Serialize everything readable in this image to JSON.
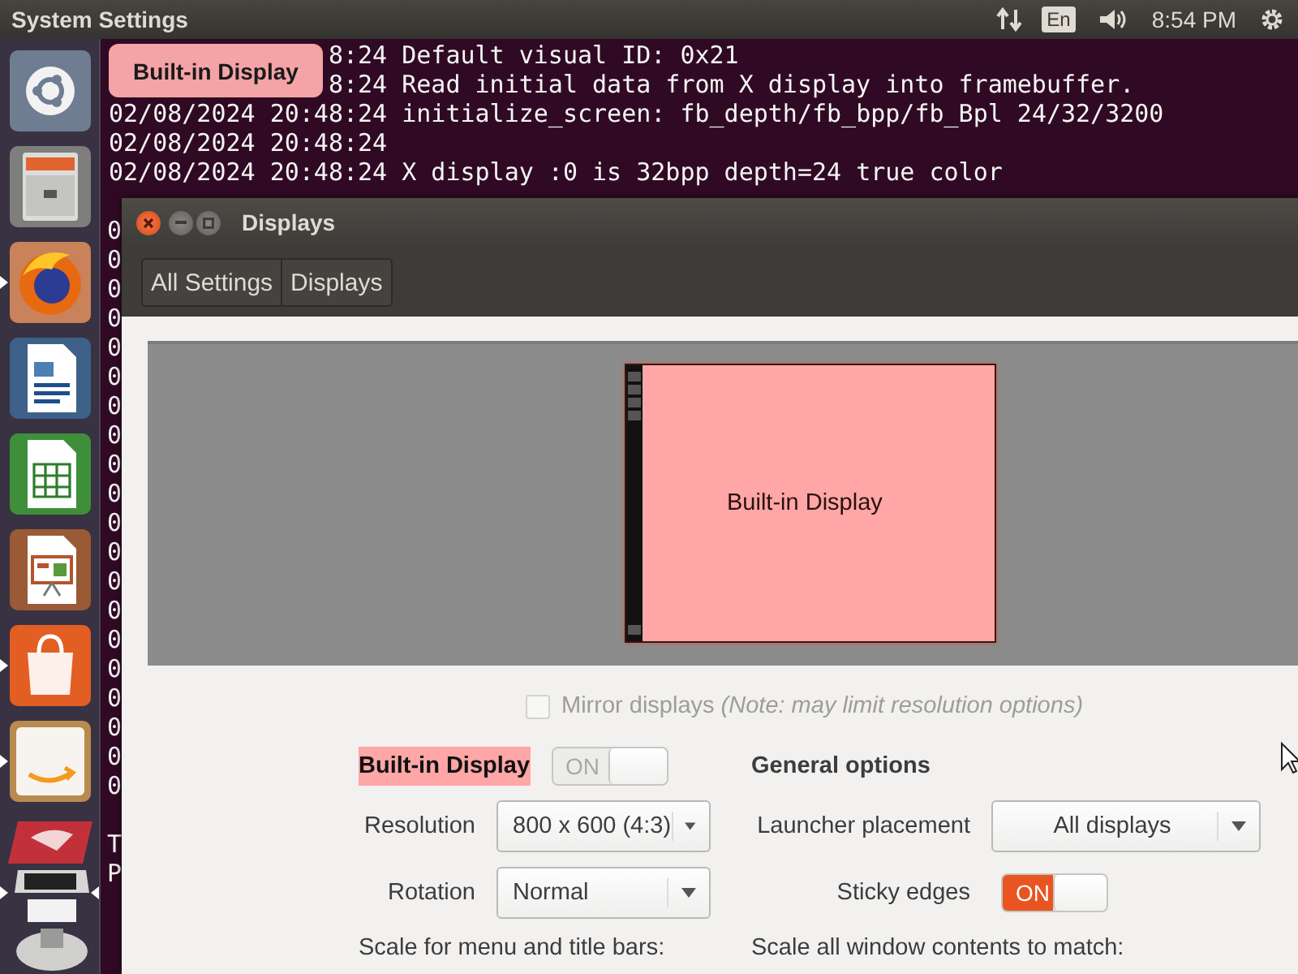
{
  "top_bar": {
    "title": "System Settings",
    "keyboard_layout": "En",
    "clock": "8:54 PM"
  },
  "launcher": {
    "items": [
      {
        "kind": "dash",
        "running": false,
        "focused": false
      },
      {
        "kind": "files",
        "running": false,
        "focused": false
      },
      {
        "kind": "browser",
        "running": true,
        "focused": false
      },
      {
        "kind": "writer",
        "running": false,
        "focused": false
      },
      {
        "kind": "calc",
        "running": false,
        "focused": false
      },
      {
        "kind": "impress",
        "running": false,
        "focused": false
      },
      {
        "kind": "software",
        "running": true,
        "focused": false
      },
      {
        "kind": "shop",
        "running": true,
        "focused": false
      },
      {
        "kind": "settings",
        "running": true,
        "focused": true
      }
    ]
  },
  "tooltip": {
    "text": "Built-in Display"
  },
  "terminal": {
    "lines": [
      {
        "text": "8:24 Default visual ID: 0x21",
        "behind_tooltip": true
      },
      {
        "text": "8:24 Read initial data from X display into framebuffer.",
        "behind_tooltip": true
      },
      {
        "text": "02/08/2024 20:48:24 initialize_screen: fb_depth/fb_bpp/fb_Bpl 24/32/3200",
        "behind_tooltip": false
      },
      {
        "text": "02/08/2024 20:48:24",
        "behind_tooltip": false
      },
      {
        "text": "02/08/2024 20:48:24 X display :0 is 32bpp depth=24 true color",
        "behind_tooltip": false
      }
    ],
    "left_edge_upper": [
      "0",
      "0",
      "0",
      "0",
      "0",
      "0",
      "0",
      "0",
      "0",
      "0",
      "0",
      "0",
      "0",
      "0",
      "0",
      "0",
      "0",
      "0",
      "0",
      "0"
    ],
    "left_edge_lower": [
      "T",
      "P"
    ]
  },
  "window": {
    "title": "Displays",
    "breadcrumbs": [
      {
        "label": "All Settings"
      },
      {
        "label": "Displays"
      }
    ],
    "monitor": {
      "label": "Built-in Display"
    },
    "mirror": {
      "label": "Mirror displays *(Note: may limit resolution options)*",
      "checked": false,
      "disabled": true
    },
    "display_section": {
      "name": "Built-in Display",
      "switch": {
        "label": "ON",
        "on": true,
        "disabled": true
      },
      "rows": [
        {
          "label": "Resolution",
          "value": "800 x 600 (4:3)"
        },
        {
          "label": "Rotation",
          "value": "Normal"
        }
      ],
      "footer": "Scale for menu and title bars:"
    },
    "general": {
      "heading": "General options",
      "launcher_placement": {
        "label": "Launcher placement",
        "value": "All displays"
      },
      "sticky_edges": {
        "label": "Sticky edges",
        "switch_label": "ON",
        "on": true
      },
      "footer": "Scale all window contents to match:"
    }
  }
}
